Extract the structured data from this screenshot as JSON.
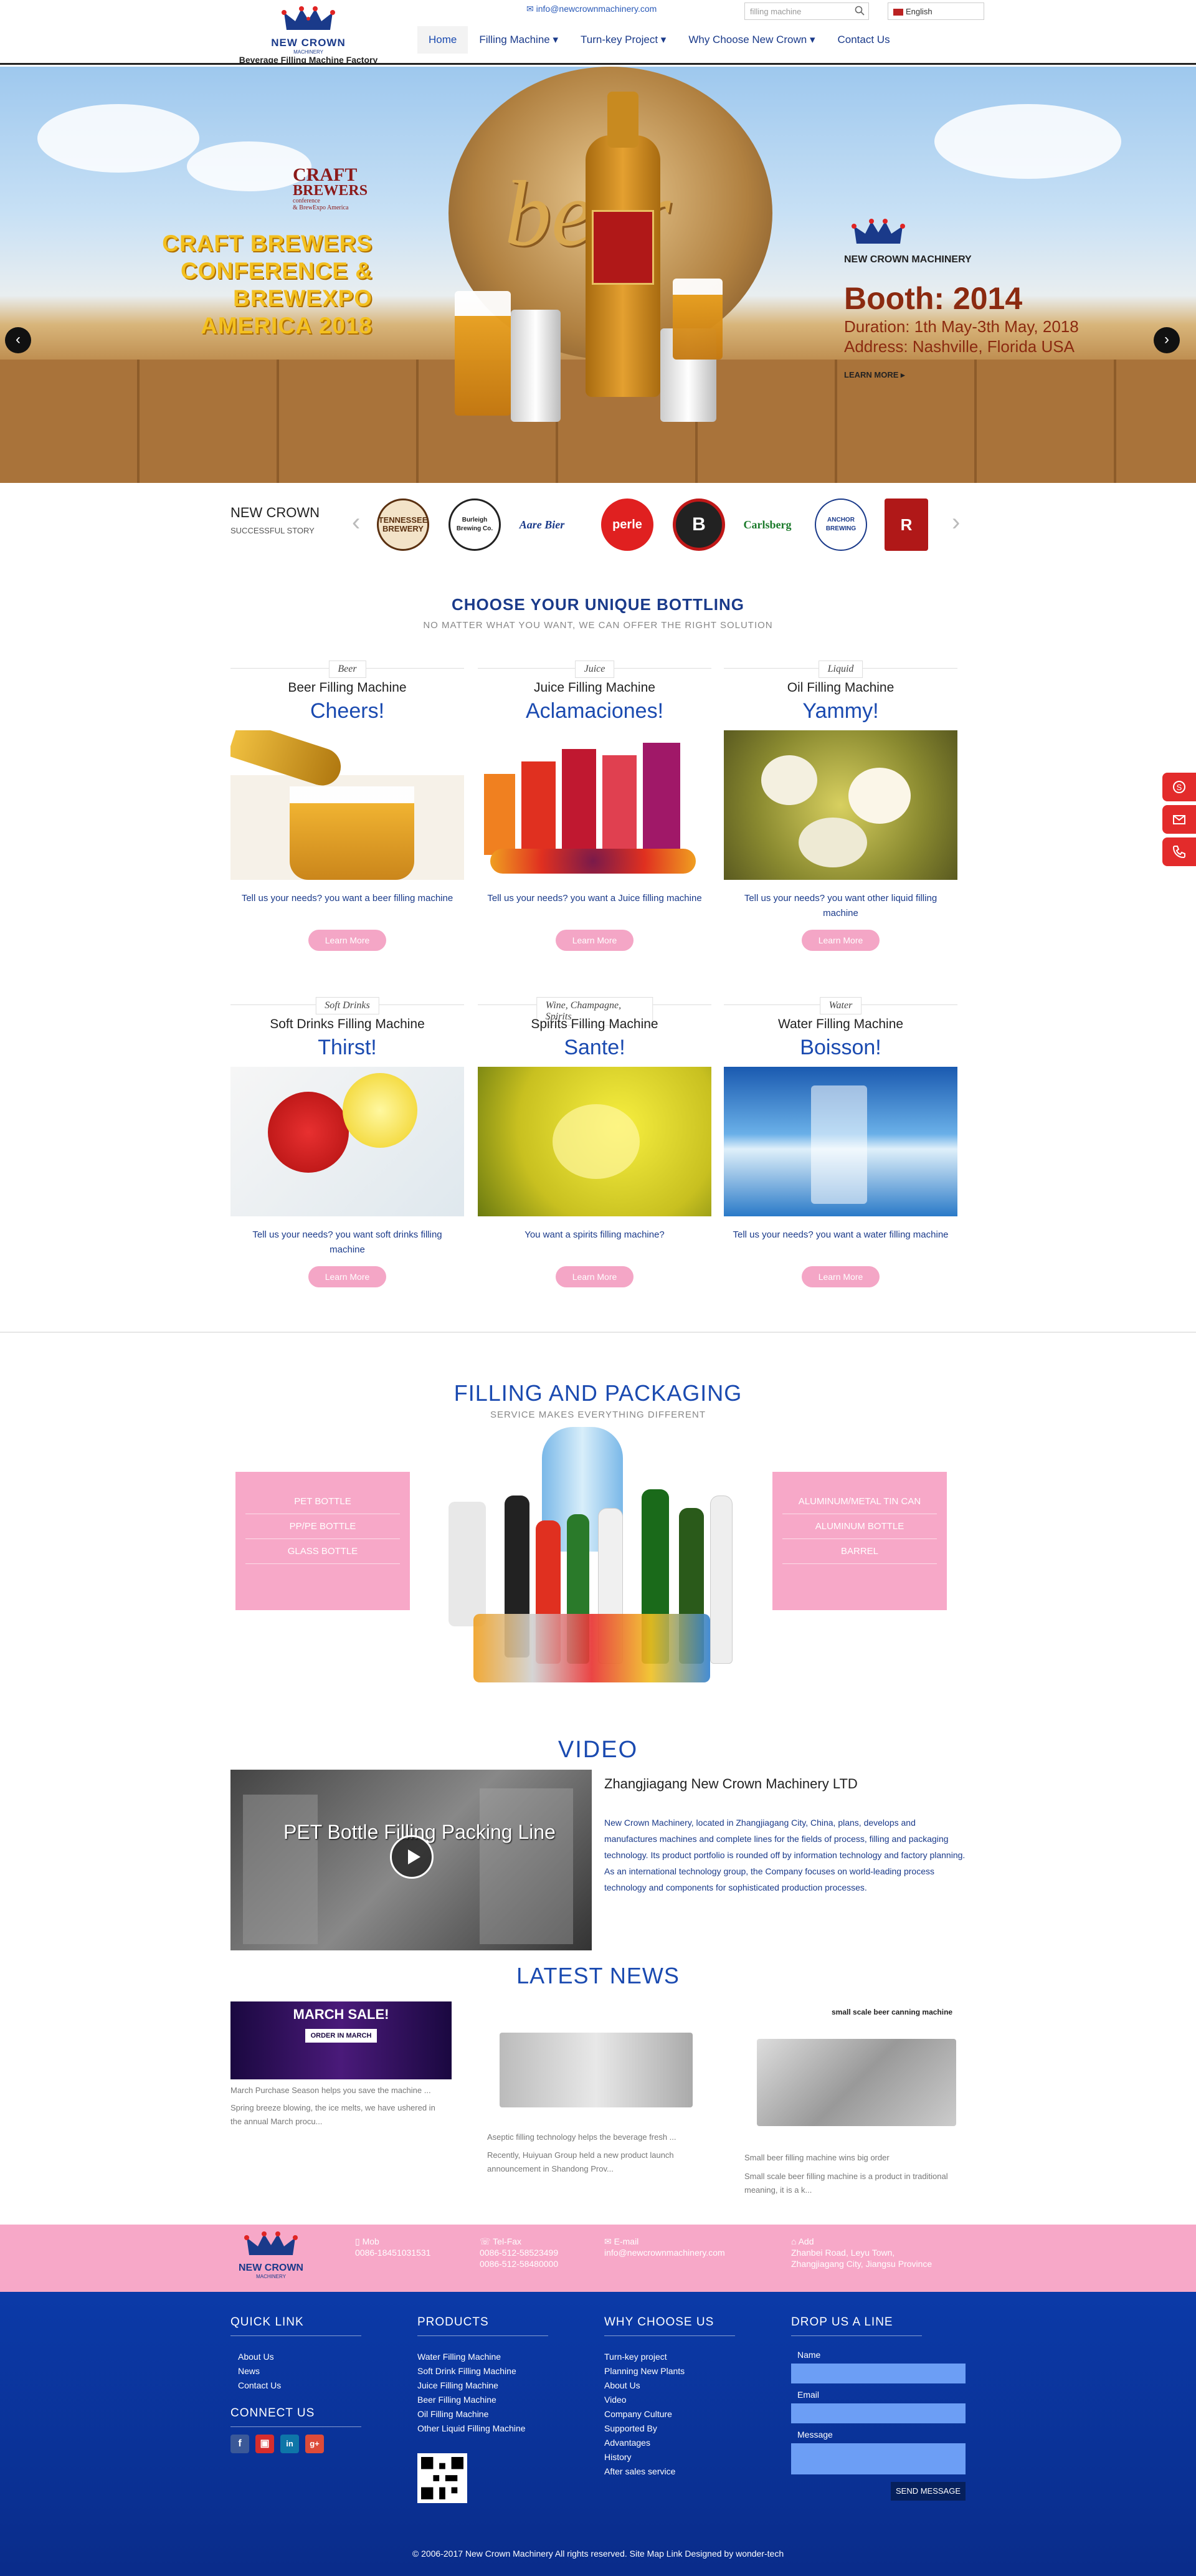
{
  "header": {
    "logo_name": "NEW CROWN",
    "logo_sub": "MACHINERY",
    "logo_tag": "Beverage Filling Machine Factory",
    "email": "info@newcrownmachinery.com",
    "search_placeholder": "filling machine",
    "language": "English",
    "nav": [
      {
        "label": "Home"
      },
      {
        "label": "Filling Machine ▾"
      },
      {
        "label": "Turn-key Project ▾"
      },
      {
        "label": "Why Choose New Crown ▾"
      },
      {
        "label": "Contact Us"
      }
    ]
  },
  "banner": {
    "craft_1": "CRAFT",
    "craft_2": "BREWERS",
    "craft_3": "conference",
    "craft_4": "& BrewExpo America",
    "conf_lines": [
      "CRAFT BREWERS",
      "CONFERENCE & BREWEXPO",
      "AMERICA 2018"
    ],
    "brand": "NEW CROWN MACHINERY",
    "booth": "Booth: 2014",
    "duration": "Duration: 1th May-3th May, 2018",
    "address": "Address: Nashville, Florida USA",
    "learn_more": "LEARN MORE ▸",
    "barrel_text": "beer"
  },
  "story": {
    "title": "NEW CROWN",
    "subtitle": "SUCCESSFUL STORY",
    "brands": [
      "TENNESSEE BREWERY",
      "Burleigh Brewing Co.",
      "Aare Bier",
      "perle",
      "B",
      "Carlsberg",
      "ANCHOR BREWING",
      "R"
    ]
  },
  "bottling": {
    "title": "CHOOSE YOUR UNIQUE BOTTLING",
    "subtitle": "NO MATTER WHAT YOU WANT, WE CAN OFFER THE RIGHT SOLUTION",
    "cards": [
      {
        "tag": "Beer",
        "name": "Beer Filling Machine",
        "slogan": "Cheers!",
        "desc": "Tell us your needs? you want a beer filling machine",
        "btn": "Learn More"
      },
      {
        "tag": "Juice",
        "name": "Juice Filling Machine",
        "slogan": "Aclamaciones!",
        "desc": "Tell us your needs? you want a Juice filling machine",
        "btn": "Learn More"
      },
      {
        "tag": "Liquid",
        "name": "Oil Filling Machine",
        "slogan": "Yammy!",
        "desc": "Tell us your needs? you want other liquid filling machine",
        "btn": "Learn More"
      },
      {
        "tag": "Soft Drinks",
        "name": "Soft Drinks Filling Machine",
        "slogan": "Thirst!",
        "desc": "Tell us your needs? you want soft drinks filling machine",
        "btn": "Learn More"
      },
      {
        "tag": "Wine, Champagne, Spirits",
        "name": "Spirits Filling Machine",
        "slogan": "Sante!",
        "desc": "You want a spirits filling machine?",
        "btn": "Learn More"
      },
      {
        "tag": "Water",
        "name": "Water Filling Machine",
        "slogan": "Boisson!",
        "desc": "Tell us your needs? you want a water filling machine",
        "btn": "Learn More"
      }
    ]
  },
  "filling": {
    "title": "FILLING AND PACKAGING",
    "subtitle": "SERVICE MAKES EVERYTHING DIFFERENT",
    "left_options": [
      "PET BOTTLE",
      "PP/PE BOTTLE",
      "GLASS BOTTLE"
    ],
    "right_options": [
      "ALUMINUM/METAL TIN CAN",
      "ALUMINUM BOTTLE",
      "BARREL"
    ]
  },
  "video": {
    "title": "VIDEO",
    "video_text": "PET Bottle Filling Packing Line",
    "company": "Zhangjiagang New Crown Machinery LTD",
    "desc": "New Crown Machinery, located in Zhangjiagang City, China, plans, develops and manufactures machines and complete lines for the fields of process, filling and packaging technology. Its product portfolio is rounded off by information technology and factory planning. As an international technology group, the Company focuses on world-leading process technology and components for sophisticated production processes."
  },
  "news": {
    "title": "LATEST NEWS",
    "items": [
      {
        "img_text": "MARCH SALE!",
        "img_sub": "ORDER IN MARCH",
        "title": "March Purchase Season helps you save the machine ...",
        "desc": "Spring breeze blowing, the ice melts, we have ushered in the annual March procu..."
      },
      {
        "title": "Aseptic filling technology helps the beverage fresh ...",
        "desc": "Recently, Huiyuan Group held a new product launch announcement in Shandong Prov..."
      },
      {
        "img_text": "small scale beer canning machine",
        "title": "Small beer filling machine wins big order",
        "desc": "Small scale beer filling machine is a product in traditional meaning, it is a k..."
      }
    ]
  },
  "contact_bar": {
    "mob_label": "Mob",
    "mob": "0086-18451031531",
    "tel_label": "Tel-Fax",
    "tel1": "0086-512-58523499",
    "tel2": "0086-512-58480000",
    "email_label": "E-mail",
    "email": "info@newcrownmachinery.com",
    "add_label": "Add",
    "add1": "Zhanbei Road, Leyu Town,",
    "add2": "Zhangjiagang City, Jiangsu Province"
  },
  "footer": {
    "quick_title": "QUICK LINK",
    "quick_links": [
      "About Us",
      "News",
      "Contact Us"
    ],
    "connect_title": "CONNECT US",
    "social": [
      "f",
      "▣",
      "in",
      "g+"
    ],
    "products_title": "PRODUCTS",
    "products": [
      "Water Filling Machine",
      "Soft Drink Filling Machine",
      "Juice Filling Machine",
      "Beer Filling Machine",
      "Oil Filling Machine",
      "Other Liquid Filling Machine"
    ],
    "why_title": "WHY CHOOSE US",
    "why": [
      "Turn-key project",
      "Planning New Plants",
      "About Us",
      "Video",
      "Company Culture",
      "Supported By",
      "Advantages",
      "History",
      "After sales service"
    ],
    "drop_title": "DROP US A LINE",
    "name_label": "Name",
    "email_label": "Email",
    "message_label": "Message",
    "send": "SEND MESSAGE",
    "copyright": "© 2006-2017 New Crown Machinery  All rights reserved.  Site Map   Link   Designed by wonder-tech"
  },
  "colors": {
    "brand_blue": "#1a4ab0",
    "pink": "#f7a8c8",
    "footer_blue": "#0b3aa8",
    "side_red": "#e32b2b"
  }
}
